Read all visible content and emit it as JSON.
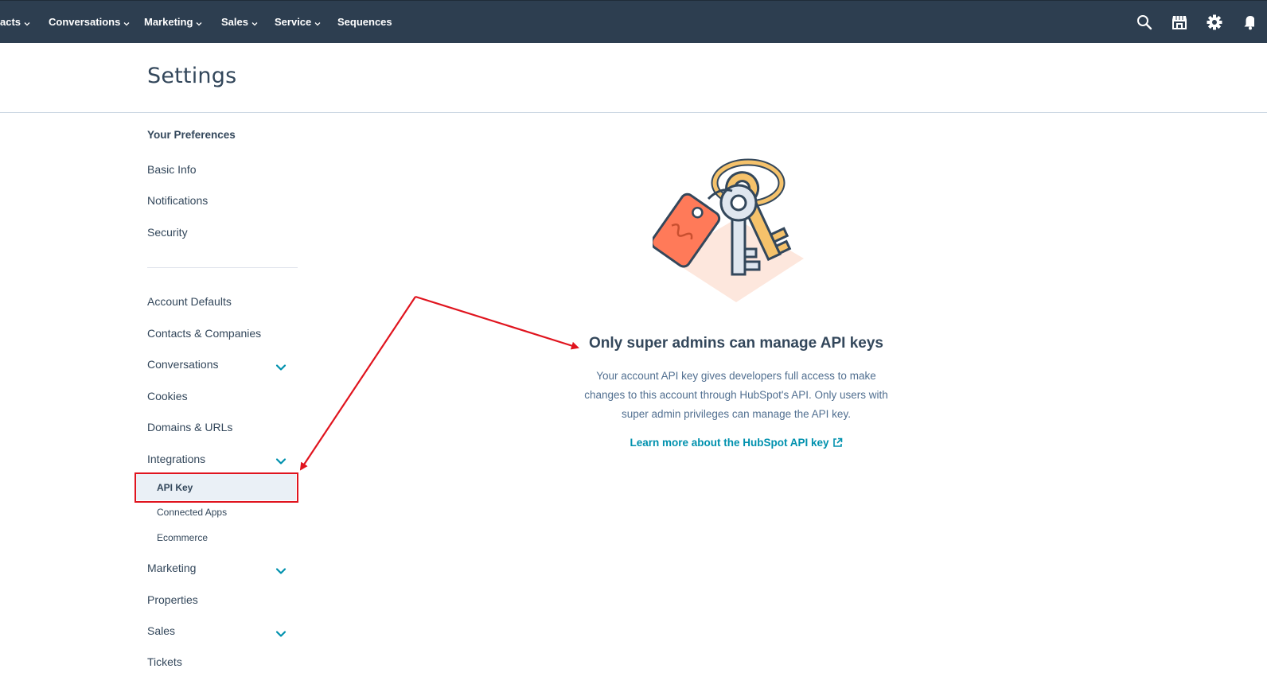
{
  "topnav": {
    "items": [
      {
        "label": "acts"
      },
      {
        "label": "Conversations"
      },
      {
        "label": "Marketing"
      },
      {
        "label": "Sales"
      },
      {
        "label": "Service"
      },
      {
        "label": "Sequences"
      }
    ],
    "icons": [
      "search-icon",
      "marketplace-icon",
      "settings-gear-icon",
      "notifications-icon"
    ],
    "background_color": "#2d3e50"
  },
  "page": {
    "title": "Settings"
  },
  "sidebar": {
    "section_heading": "Your Preferences",
    "preferences": [
      "Basic Info",
      "Notifications",
      "Security"
    ],
    "account_items": [
      {
        "label": "Account Defaults"
      },
      {
        "label": "Contacts & Companies"
      },
      {
        "label": "Conversations",
        "expandable": true
      },
      {
        "label": "Cookies"
      },
      {
        "label": "Domains & URLs"
      },
      {
        "label": "Integrations",
        "expandable": true
      }
    ],
    "integrations_sub": [
      {
        "label": "API Key",
        "active": true
      },
      {
        "label": "Connected Apps"
      },
      {
        "label": "Ecommerce"
      }
    ],
    "more_items": [
      {
        "label": "Marketing",
        "expandable": true
      },
      {
        "label": "Properties"
      },
      {
        "label": "Sales",
        "expandable": true
      },
      {
        "label": "Tickets"
      }
    ]
  },
  "main": {
    "illustration": "keys-on-keyring-illustration",
    "heading": "Only super admins can manage API keys",
    "body": "Your account API key gives developers full access to make changes to this account through HubSpot's API. Only users with super admin privileges can manage the API key.",
    "link_text": "Learn more about the HubSpot API key",
    "link_icon": "external-link-icon"
  },
  "annotation": {
    "color": "#e0141e",
    "shapes": [
      "highlight-rectangle-api-key",
      "arrow-to-sidebar",
      "arrow-to-heading"
    ]
  },
  "colors": {
    "text": "#33475b",
    "link": "#0091ae",
    "active_item_bg": "#eaf0f6",
    "chevron": "#0091ae"
  }
}
